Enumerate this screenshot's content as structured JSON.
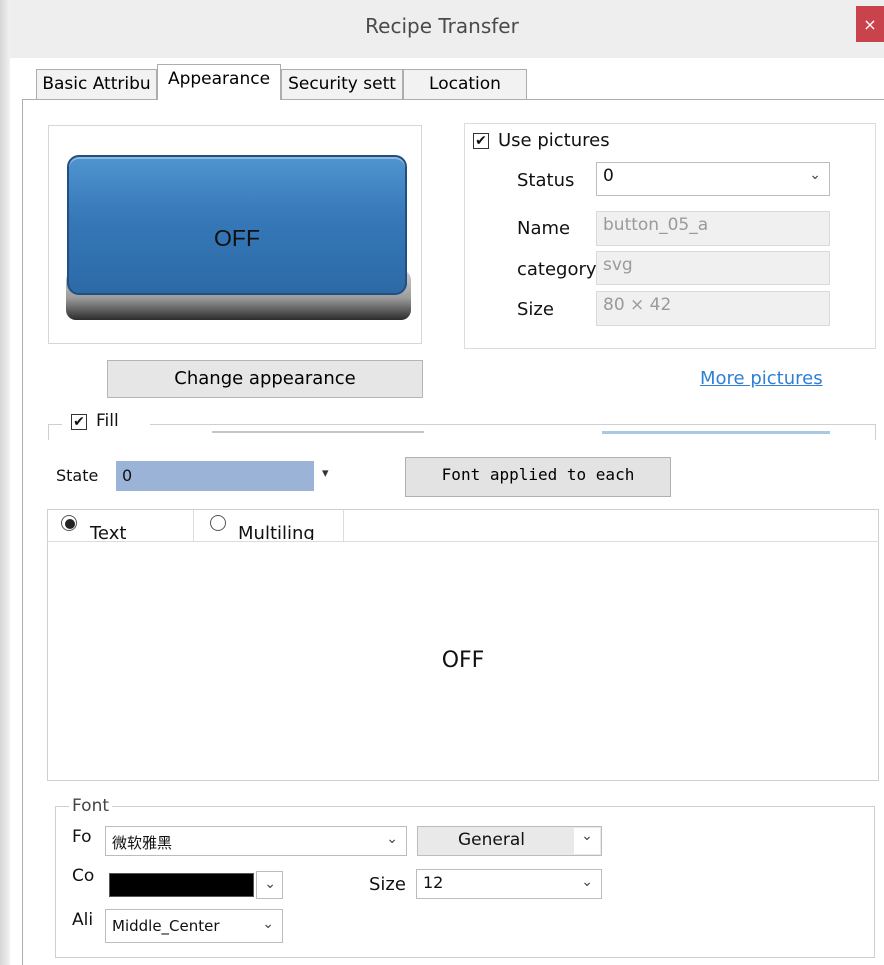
{
  "window": {
    "title": "Recipe Transfer",
    "close_glyph": "×"
  },
  "tabs": [
    {
      "label": "Basic Attribu"
    },
    {
      "label": "Appearance",
      "active": true
    },
    {
      "label": "Security sett"
    },
    {
      "label": "Location"
    }
  ],
  "preview": {
    "button_text": "OFF"
  },
  "pictures": {
    "use_pictures_label": "Use pictures",
    "use_pictures_checked": true,
    "status_label": "Status",
    "status_value": "0",
    "name_label": "Name",
    "name_value": "button_05_a",
    "category_label": "category",
    "category_value": "svg",
    "size_label": "Size",
    "size_value": "80 × 42"
  },
  "change_appearance_label": "Change appearance",
  "more_pictures_label": "More pictures",
  "fill": {
    "label": "Fill",
    "checked": true
  },
  "state": {
    "label": "State",
    "value": "0"
  },
  "font_applied_label": "Font applied to each",
  "text_tabs": [
    {
      "label": "Text",
      "selected": true
    },
    {
      "label": "Multiling",
      "selected": false
    }
  ],
  "text_preview": "OFF",
  "font": {
    "group_title": "Font",
    "font_label": "Fo",
    "font_value": "微软雅黑",
    "style_value": "General",
    "color_label": "Co",
    "color_value": "#000000",
    "size_label": "Size",
    "size_value": "12",
    "align_label": "Ali",
    "align_value": "Middle_Center"
  },
  "icons": {
    "checkbox_check": "✔",
    "dropdown": "⌄"
  },
  "colors": {
    "close_button": "#c8434c",
    "button_face": "#3678b8",
    "state_highlight": "#9bb3d6",
    "link": "#2f7fd5"
  }
}
